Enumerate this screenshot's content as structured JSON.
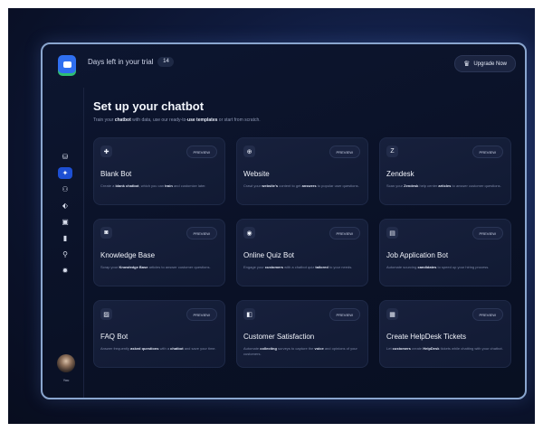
{
  "header": {
    "trial_label": "Days left in your trial",
    "trial_days": "14",
    "upgrade_label": "Upgrade Now"
  },
  "sidebar": {
    "items": [
      {
        "name": "database-icon",
        "glyph": "⛁"
      },
      {
        "name": "chatbot-icon",
        "glyph": "✦"
      },
      {
        "name": "users-icon",
        "glyph": "⚇"
      },
      {
        "name": "tag-icon",
        "glyph": "⬖"
      },
      {
        "name": "inbox-icon",
        "glyph": "▣"
      },
      {
        "name": "chart-icon",
        "glyph": "▮"
      },
      {
        "name": "integrations-icon",
        "glyph": "⚲"
      },
      {
        "name": "settings-icon",
        "glyph": "✹"
      }
    ],
    "active_index": 1,
    "user_name": "You"
  },
  "main": {
    "title": "Set up your chatbot",
    "subtitle": {
      "p1": "Train your ",
      "b1": "chatbot",
      "p2": " with data, use our ready-to-",
      "b2": "use templates",
      "p3": " or start from scratch."
    },
    "preview_label": "PREVIEW",
    "cards": [
      {
        "title": "Blank Bot",
        "icon": "✚",
        "desc": [
          {
            "t": "Create a "
          },
          {
            "t": "blank chatbot",
            "b": true
          },
          {
            "t": ", which you can "
          },
          {
            "t": "train",
            "b": true
          },
          {
            "t": " and customize later."
          }
        ]
      },
      {
        "title": "Website",
        "icon": "⊕",
        "desc": [
          {
            "t": "Crawl your "
          },
          {
            "t": "website's",
            "b": true
          },
          {
            "t": " content to get "
          },
          {
            "t": "answers",
            "b": true
          },
          {
            "t": " to popular user questions."
          }
        ]
      },
      {
        "title": "Zendesk",
        "icon": "Z",
        "desc": [
          {
            "t": "Scan your "
          },
          {
            "t": "Zendesk",
            "b": true
          },
          {
            "t": " help center "
          },
          {
            "t": "articles",
            "b": true
          },
          {
            "t": " to answer customer questions."
          }
        ]
      },
      {
        "title": "Knowledge Base",
        "icon": "◙",
        "desc": [
          {
            "t": "Scrap your "
          },
          {
            "t": "Knowledge Base",
            "b": true
          },
          {
            "t": " articles to answer customer questions."
          }
        ]
      },
      {
        "title": "Online Quiz Bot",
        "icon": "◉",
        "desc": [
          {
            "t": "Engage your "
          },
          {
            "t": "customers",
            "b": true
          },
          {
            "t": " with a chatbot quiz "
          },
          {
            "t": "tailored",
            "b": true
          },
          {
            "t": " to your needs."
          }
        ]
      },
      {
        "title": "Job Application Bot",
        "icon": "▤",
        "desc": [
          {
            "t": "Automate sourcing "
          },
          {
            "t": "candidates",
            "b": true
          },
          {
            "t": " to speed up your hiring process."
          }
        ]
      },
      {
        "title": "FAQ Bot",
        "icon": "▨",
        "desc": [
          {
            "t": "Answer frequently "
          },
          {
            "t": "asked questions",
            "b": true
          },
          {
            "t": " with a "
          },
          {
            "t": "chatbot",
            "b": true
          },
          {
            "t": " and save your time."
          }
        ]
      },
      {
        "title": "Customer Satisfaction",
        "icon": "◧",
        "desc": [
          {
            "t": "Automate "
          },
          {
            "t": "collecting",
            "b": true
          },
          {
            "t": " surveys to capture the "
          },
          {
            "t": "voice",
            "b": true
          },
          {
            "t": " and opinions of your customers."
          }
        ]
      },
      {
        "title": "Create HelpDesk Tickets",
        "icon": "▦",
        "desc": [
          {
            "t": "Let "
          },
          {
            "t": "customers",
            "b": true
          },
          {
            "t": " create "
          },
          {
            "t": "HelpDesk",
            "b": true
          },
          {
            "t": " tickets while chatting with your chatbot."
          }
        ]
      }
    ]
  },
  "colors": {
    "accent": "#2f6ff0",
    "active_nav": "#1d4fd3",
    "frame_border": "#8aa6cf",
    "logo_underline": "#2fbf73"
  }
}
